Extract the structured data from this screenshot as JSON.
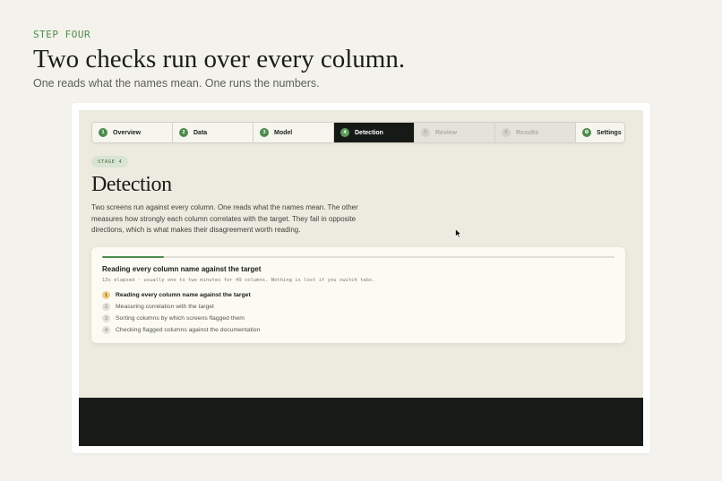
{
  "intro": {
    "eyebrow": "STEP FOUR",
    "title": "Two checks run over every column.",
    "subtitle": "One reads what the names mean. One runs the numbers."
  },
  "stepper": {
    "steps": [
      {
        "number": "1",
        "label": "Overview",
        "state": "done"
      },
      {
        "number": "2",
        "label": "Data",
        "state": "done"
      },
      {
        "number": "3",
        "label": "Model",
        "state": "done"
      },
      {
        "number": "4",
        "label": "Detection",
        "state": "active"
      },
      {
        "number": "5",
        "label": "Review",
        "state": "disabled"
      },
      {
        "number": "6",
        "label": "Results",
        "state": "disabled"
      },
      {
        "number": "⚙",
        "label": "Settings",
        "state": "done"
      }
    ]
  },
  "stage": {
    "badge": "STAGE 4",
    "title": "Detection",
    "description": "Two screens run against every column. One reads what the names mean. The other measures how strongly each column correlates with the target. They fail in opposite directions, which is what makes their disagreement worth reading."
  },
  "progress": {
    "fraction": 0.12,
    "title": "Reading every column name against the target",
    "meta": "13s elapsed · usually one to two minutes for 49 columns. Nothing is lost if you switch tabs.",
    "tasks": [
      {
        "number": "1",
        "label": "Reading every column name against the target",
        "current": true
      },
      {
        "number": "2",
        "label": "Measuring correlation with the target",
        "current": false
      },
      {
        "number": "3",
        "label": "Sorting columns by which screens flagged them",
        "current": false
      },
      {
        "number": "4",
        "label": "Checking flagged columns against the documentation",
        "current": false
      }
    ]
  },
  "colors": {
    "accent": "#4e8a4d",
    "active_step": "#161a17",
    "current_task": "#f2cf86"
  }
}
